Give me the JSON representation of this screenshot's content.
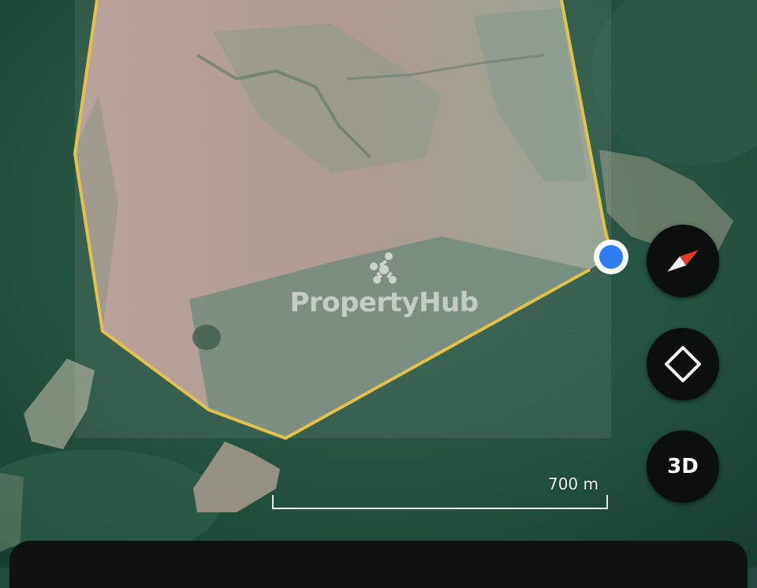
{
  "map": {
    "type": "satellite",
    "boundary_color": "#e2c24a",
    "location_dot_color": "#2f7cf0"
  },
  "watermark": {
    "text": "PropertyHub"
  },
  "controls": {
    "compass_icon": "compass-icon",
    "locate_icon": "locate-icon",
    "three_d_label": "3D"
  },
  "scale": {
    "label": "700 m"
  },
  "colors": {
    "control_bg": "#0b0f0e",
    "compass_red": "#e23b2a",
    "sheet_bg": "#101212"
  }
}
